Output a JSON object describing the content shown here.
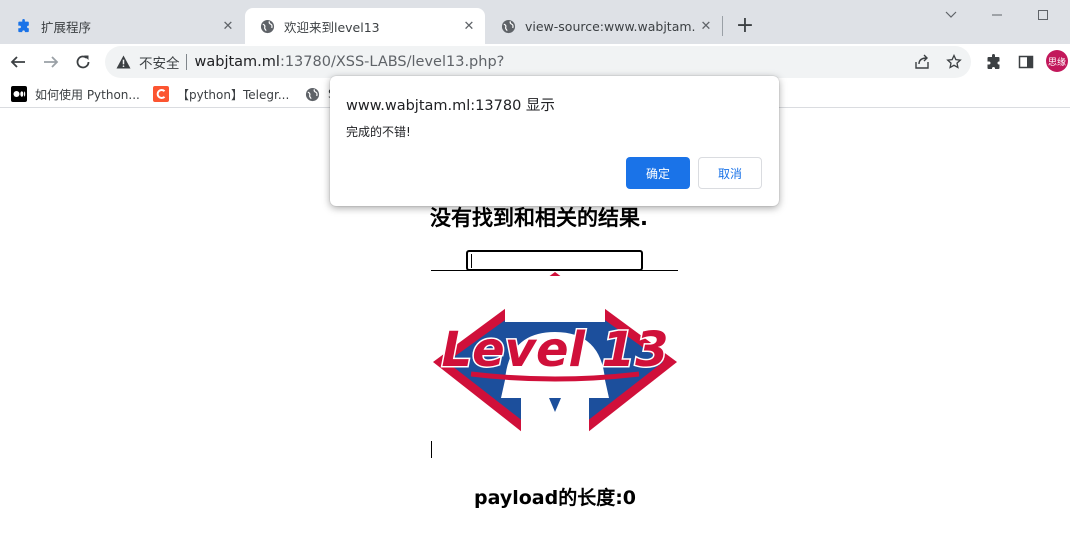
{
  "tabs": [
    {
      "label": "扩展程序",
      "icon": "puzzle-icon",
      "active": false
    },
    {
      "label": "欢迎来到level13",
      "icon": "globe-icon",
      "active": true
    },
    {
      "label": "view-source:www.wabjtam.ml:",
      "icon": "globe-icon",
      "active": false
    }
  ],
  "newtab_label": "+",
  "address": {
    "insecure_label": "不安全",
    "host": "wabjtam.ml",
    "path": ":13780/XSS-LABS/level13.php?"
  },
  "profile": {
    "initials": "思缘",
    "color": "#c2185b"
  },
  "bookmarks": [
    {
      "label": "如何使用 Python...",
      "icon": "medium-icon"
    },
    {
      "label": "【python】Telegr...",
      "icon": "csdn-icon"
    },
    {
      "label": "S",
      "icon": "globe-icon"
    }
  ],
  "page": {
    "heading": "没有找到和相关的结果.",
    "logo_text": "Level 13",
    "payload_label": "payload的长度:0"
  },
  "dialog": {
    "title": "www.wabjtam.ml:13780 显示",
    "message": "完成的不错!",
    "ok_label": "确定",
    "cancel_label": "取消"
  },
  "colors": {
    "tabstrip": "#dee1e6",
    "accent": "#1a73e8",
    "logo_red": "#d0103a",
    "logo_blue": "#1c4f9c"
  }
}
